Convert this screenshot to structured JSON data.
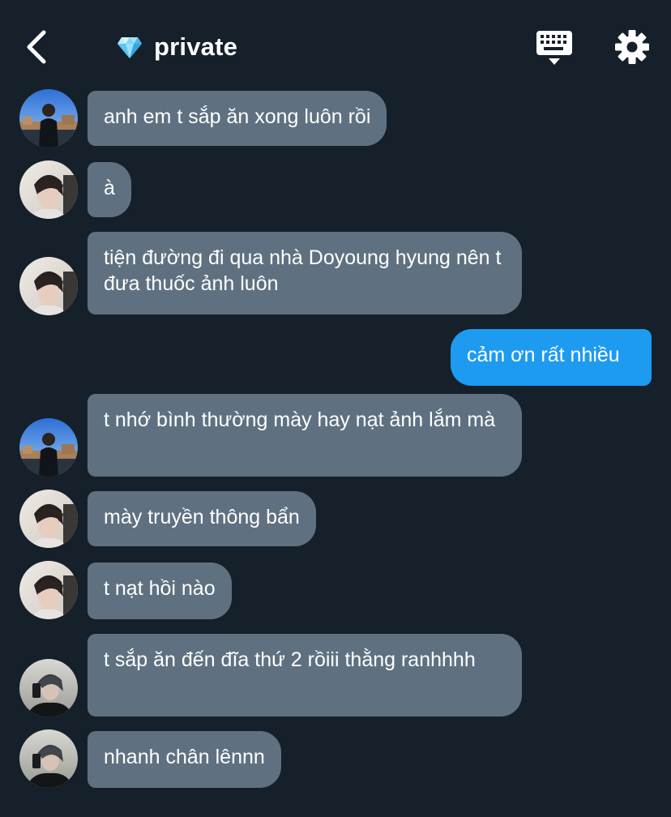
{
  "header": {
    "back_icon": "chevron-left-icon",
    "title_icon": "gem-icon",
    "title": "private",
    "keyboard_icon": "keyboard-icon",
    "settings_icon": "gear-icon"
  },
  "colors": {
    "background": "#16202b",
    "incoming_bubble": "#5f7181",
    "outgoing_bubble": "#1d9bf0",
    "text": "#ffffff"
  },
  "messages": [
    {
      "sender": "user-a",
      "direction": "incoming",
      "text": "anh em t sắp ăn xong luôn rồi"
    },
    {
      "sender": "user-b",
      "direction": "incoming",
      "text": "à"
    },
    {
      "sender": "user-b",
      "direction": "incoming",
      "text": "tiện đường đi qua nhà Doyoung hyung nên t đưa thuốc ảnh luôn"
    },
    {
      "sender": "me",
      "direction": "outgoing",
      "text": "cảm ơn rất nhiều"
    },
    {
      "sender": "user-a",
      "direction": "incoming",
      "text": "t nhớ bình thường mày hay nạt ảnh lắm mà"
    },
    {
      "sender": "user-b",
      "direction": "incoming",
      "text": "mày truyền thông bẩn"
    },
    {
      "sender": "user-b",
      "direction": "incoming",
      "text": "t nạt hồi nào"
    },
    {
      "sender": "user-c",
      "direction": "incoming",
      "text": "t sắp ăn đến đĩa thứ 2 rồiii thằng ranhhhh"
    },
    {
      "sender": "user-c",
      "direction": "incoming",
      "text": "nhanh chân lênnn"
    }
  ]
}
